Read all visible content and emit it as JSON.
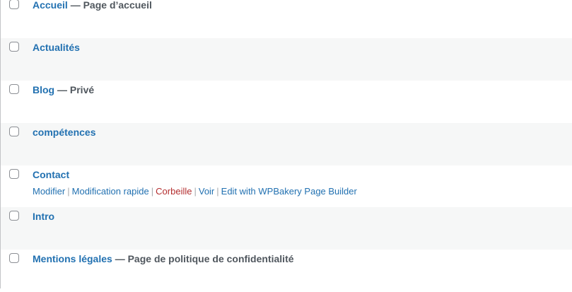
{
  "pages": [
    {
      "title": "Accueil",
      "state": "Page d’accueil"
    },
    {
      "title": "Actualités",
      "state": ""
    },
    {
      "title": "Blog",
      "state": "Privé"
    },
    {
      "title": "compétences",
      "state": ""
    },
    {
      "title": "Contact",
      "state": ""
    },
    {
      "title": "Intro",
      "state": ""
    },
    {
      "title": "Mentions légales",
      "state": "Page de politique de confidentialité"
    }
  ],
  "state_separator": " — ",
  "row_actions": {
    "edit": "Modifier",
    "quick_edit": "Modification rapide",
    "trash": "Corbeille",
    "view": "Voir",
    "wpbakery": "Edit with WPBakery Page Builder"
  },
  "colors": {
    "link": "#2271b1",
    "trash": "#b32d2e",
    "alt_row": "#f6f7f7"
  }
}
